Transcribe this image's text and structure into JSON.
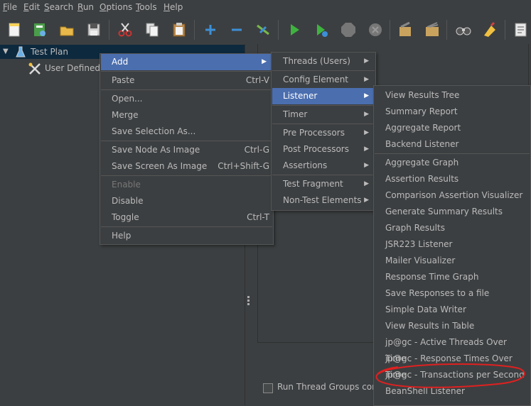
{
  "menubar": {
    "items": [
      "File",
      "Edit",
      "Search",
      "Run",
      "Options",
      "Tools",
      "Help"
    ],
    "mnemonics": [
      "F",
      "E",
      "S",
      "R",
      "O",
      "T",
      "H"
    ]
  },
  "toolbar": {
    "icons": [
      "new-icon",
      "templates-icon",
      "open-icon",
      "save-icon",
      "cut-icon",
      "copy-icon",
      "paste-icon",
      "expand-icon",
      "collapse-icon",
      "toggle-icon",
      "start-icon",
      "start-no-pause-icon",
      "stop-icon",
      "shutdown-icon",
      "clear-icon",
      "clear-all-icon",
      "search-icon",
      "reset-search-icon",
      "function-helper-icon"
    ]
  },
  "tree": {
    "items": [
      {
        "label": "Test Plan",
        "icon": "flask-icon"
      },
      {
        "label": "User Defined V",
        "icon": "wrench-icon"
      }
    ]
  },
  "right_panel": {
    "checkbox_label": "Run Thread Groups cons"
  },
  "context_menu": {
    "items": [
      {
        "label": "Add",
        "shortcut": "",
        "submenu": true,
        "selected": true
      },
      {
        "label": "Paste",
        "shortcut": "Ctrl-V"
      },
      {
        "label": "Open...",
        "shortcut": ""
      },
      {
        "label": "Merge",
        "shortcut": ""
      },
      {
        "label": "Save Selection As...",
        "shortcut": ""
      },
      {
        "label": "Save Node As Image",
        "shortcut": "Ctrl-G"
      },
      {
        "label": "Save Screen As Image",
        "shortcut": "Ctrl+Shift-G"
      },
      {
        "label": "Enable",
        "shortcut": "",
        "disabled": true
      },
      {
        "label": "Disable",
        "shortcut": ""
      },
      {
        "label": "Toggle",
        "shortcut": "Ctrl-T"
      },
      {
        "label": "Help",
        "shortcut": ""
      }
    ]
  },
  "add_menu": {
    "items": [
      {
        "label": "Threads (Users)"
      },
      {
        "label": "Config Element"
      },
      {
        "label": "Listener",
        "selected": true
      },
      {
        "label": "Timer"
      },
      {
        "label": "Pre Processors"
      },
      {
        "label": "Post Processors"
      },
      {
        "label": "Assertions"
      },
      {
        "label": "Test Fragment"
      },
      {
        "label": "Non-Test Elements"
      }
    ]
  },
  "listener_menu": {
    "items": [
      "View Results Tree",
      "Summary Report",
      "Aggregate Report",
      "Backend Listener",
      "Aggregate Graph",
      "Assertion Results",
      "Comparison Assertion Visualizer",
      "Generate Summary Results",
      "Graph Results",
      "JSR223 Listener",
      "Mailer Visualizer",
      "Response Time Graph",
      "Save Responses to a file",
      "Simple Data Writer",
      "View Results in Table",
      "jp@gc - Active Threads Over Time",
      "jp@gc - Response Times Over Time",
      "jp@gc - Transactions per Second",
      "BeanShell Listener"
    ]
  },
  "colors": {
    "background": "#3c3f41",
    "selection": "#4b6eaf",
    "annotation": "#e02020"
  }
}
